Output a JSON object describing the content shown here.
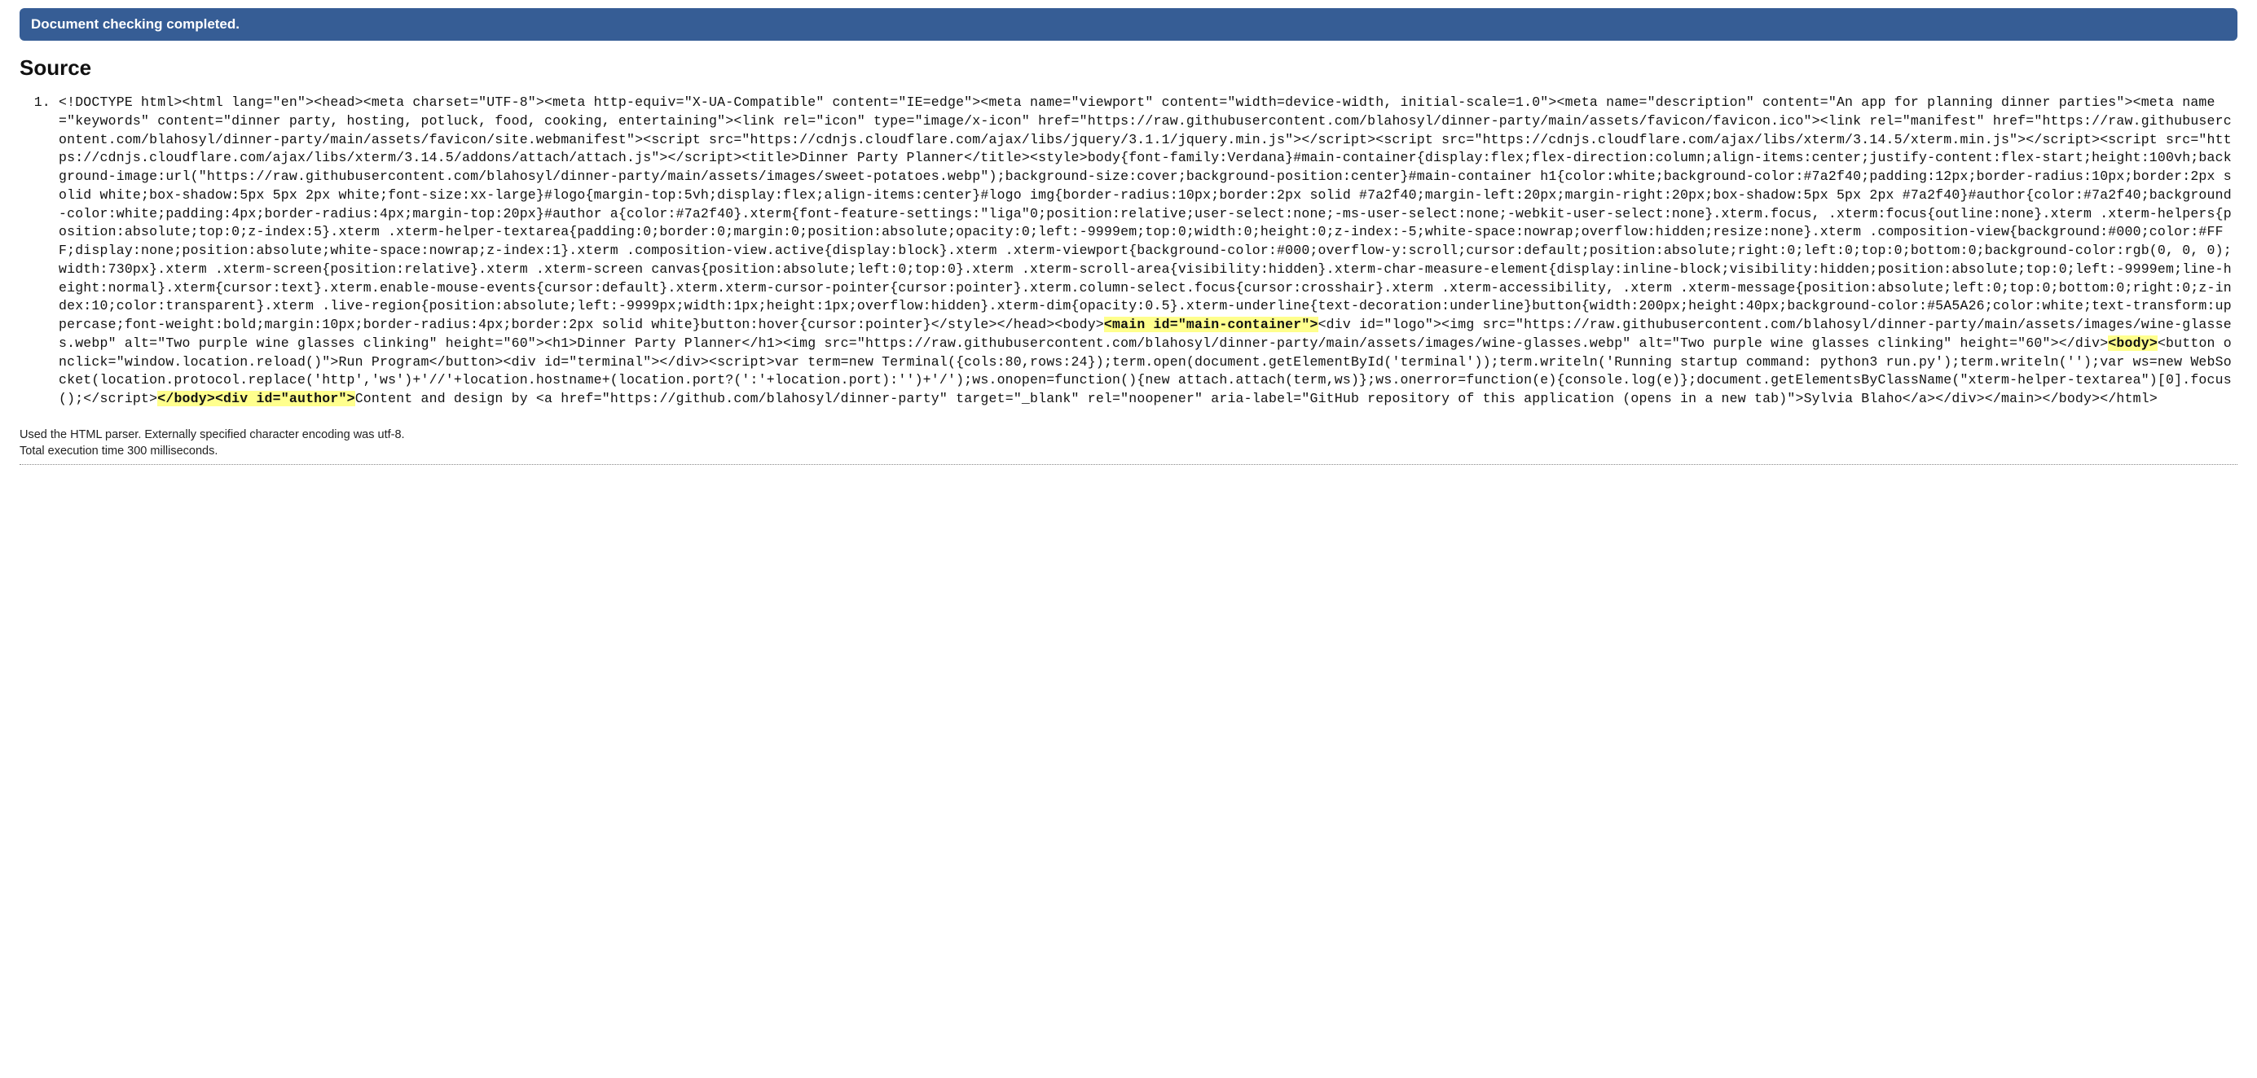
{
  "status": {
    "message": "Document checking completed."
  },
  "source": {
    "heading": "Source",
    "list_number": 1,
    "segments": [
      {
        "t": "plain",
        "v": "<!DOCTYPE html><html lang=\"en\"><head><meta charset=\"UTF-8\"><meta http-equiv=\"X-UA-Compatible\" content=\"IE=edge\"><meta name=\"viewport\" content=\"width=device-width, initial-scale=1.0\"><meta name=\"description\" content=\"An app for planning dinner parties\"><meta name=\"keywords\" content=\"dinner party, hosting, potluck, food, cooking, entertaining\"><link rel=\"icon\" type=\"image/x-icon\" href=\"https://raw.githubusercontent.com/blahosyl/dinner-party/main/assets/favicon/favicon.ico\"><link rel=\"manifest\" href=\"https://raw.githubusercontent.com/blahosyl/dinner-party/main/assets/favicon/site.webmanifest\"><script src=\"https://cdnjs.cloudflare.com/ajax/libs/jquery/3.1.1/jquery.min.js\"></script><script src=\"https://cdnjs.cloudflare.com/ajax/libs/xterm/3.14.5/xterm.min.js\"></script><script src=\"https://cdnjs.cloudflare.com/ajax/libs/xterm/3.14.5/addons/attach/attach.js\"></script><title>Dinner Party Planner</title><style>body{font-family:Verdana}#main-container{display:flex;flex-direction:column;align-items:center;justify-content:flex-start;height:100vh;background-image:url(\"https://raw.githubusercontent.com/blahosyl/dinner-party/main/assets/images/sweet-potatoes.webp\");background-size:cover;background-position:center}#main-container h1{color:white;background-color:#7a2f40;padding:12px;border-radius:10px;border:2px solid white;box-shadow:5px 5px 2px white;font-size:xx-large}#logo{margin-top:5vh;display:flex;align-items:center}#logo img{border-radius:10px;border:2px solid #7a2f40;margin-left:20px;margin-right:20px;box-shadow:5px 5px 2px #7a2f40}#author{color:#7a2f40;background-color:white;padding:4px;border-radius:4px;margin-top:20px}#author a{color:#7a2f40}.xterm{font-feature-settings:\"liga\"0;position:relative;user-select:none;-ms-user-select:none;-webkit-user-select:none}.xterm.focus, .xterm:focus{outline:none}.xterm .xterm-helpers{position:absolute;top:0;z-index:5}.xterm .xterm-helper-textarea{padding:0;border:0;margin:0;position:absolute;opacity:0;left:-9999em;top:0;width:0;height:0;z-index:-5;white-space:nowrap;overflow:hidden;resize:none}.xterm .composition-view{background:#000;color:#FFF;display:none;position:absolute;white-space:nowrap;z-index:1}.xterm .composition-view.active{display:block}.xterm .xterm-viewport{background-color:#000;overflow-y:scroll;cursor:default;position:absolute;right:0;left:0;top:0;bottom:0;background-color:rgb(0, 0, 0);width:730px}.xterm .xterm-screen{position:relative}.xterm .xterm-screen canvas{position:absolute;left:0;top:0}.xterm .xterm-scroll-area{visibility:hidden}.xterm-char-measure-element{display:inline-block;visibility:hidden;position:absolute;top:0;left:-9999em;line-height:normal}.xterm{cursor:text}.xterm.enable-mouse-events{cursor:default}.xterm.xterm-cursor-pointer{cursor:pointer}.xterm.column-select.focus{cursor:crosshair}.xterm .xterm-accessibility, .xterm .xterm-message{position:absolute;left:0;top:0;bottom:0;right:0;z-index:10;color:transparent}.xterm .live-region{position:absolute;left:-9999px;width:1px;height:1px;overflow:hidden}.xterm-dim{opacity:0.5}.xterm-underline{text-decoration:underline}button{width:200px;height:40px;background-color:#5A5A26;color:white;text-transform:uppercase;font-weight:bold;margin:10px;border-radius:4px;border:2px solid white}button:hover{cursor:pointer}</style></head><body>"
      },
      {
        "t": "hl",
        "v": "<main id=\"main-container\">"
      },
      {
        "t": "plain",
        "v": "<div id=\"logo\"><img src=\"https://raw.githubusercontent.com/blahosyl/dinner-party/main/assets/images/wine-glasses.webp\" alt=\"Two purple wine glasses clinking\" height=\"60\"><h1>Dinner Party Planner</h1><img src=\"https://raw.githubusercontent.com/blahosyl/dinner-party/main/assets/images/wine-glasses.webp\" alt=\"Two purple wine glasses clinking\" height=\"60\"></div>"
      },
      {
        "t": "hl",
        "v": "<body>"
      },
      {
        "t": "plain",
        "v": "<button onclick=\"window.location.reload()\">Run Program</button><div id=\"terminal\"></div><script>var term=new Terminal({cols:80,rows:24});term.open(document.getElementById('terminal'));term.writeln('Running startup command: python3 run.py');term.writeln('');var ws=new WebSocket(location.protocol.replace('http','ws')+'//'+location.hostname+(location.port?(':'+location.port):'')+'/');ws.onopen=function(){new attach.attach(term,ws)};ws.onerror=function(e){console.log(e)};document.getElementsByClassName(\"xterm-helper-textarea\")[0].focus();</script>"
      },
      {
        "t": "hl",
        "v": "</body><div id=\"author\">"
      },
      {
        "t": "plain",
        "v": "Content and design by <a href=\"https://github.com/blahosyl/dinner-party\" target=\"_blank\" rel=\"noopener\" aria-label=\"GitHub repository of this application (opens in a new tab)\">Sylvia Blaho</a></div></main></body></html>"
      }
    ]
  },
  "footnotes": {
    "parser_line": "Used the HTML parser. Externally specified character encoding was utf-8.",
    "timing_line": "Total execution time 300 milliseconds."
  }
}
